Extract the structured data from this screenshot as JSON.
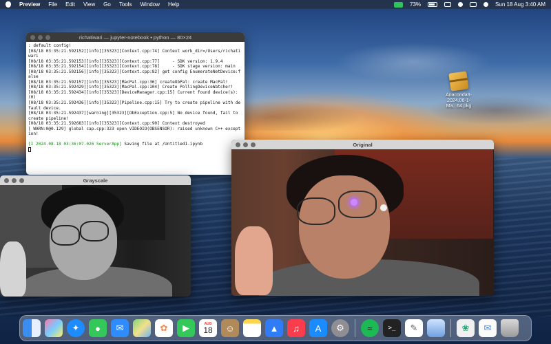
{
  "menubar": {
    "app": "Preview",
    "menus": [
      "File",
      "Edit",
      "View",
      "Go",
      "Tools",
      "Window",
      "Help"
    ],
    "battery": "73%",
    "datetime": "Sun 18 Aug  3:40 AM"
  },
  "terminal": {
    "title": "richatiwari — jupyter-notebook • python — 80×24",
    "lines": [
      ": default config!",
      "[08/18 03:35:21.592152][info][35323][Context.cpp:74] Context work_dir=/Users/richatiwari",
      "[08/18 03:35:21.592153][info][35323][Context.cpp:77]     - SDK version: 1.9.4",
      "[08/18 03:35:21.592154][info][35323][Context.cpp:78]     - SDK stage version: main",
      "[08/18 03:35:21.592156][info][35323][Context.cpp:82] get config EnumerateNetDevice:false",
      "[08/18 03:35:21.592157][info][35323][MacPal.cpp:36] createObPal: create MacPal!",
      "[08/18 03:35:21.592429][info][35323][MacPal.cpp:104] Create PollingDeviceWatcher!",
      "[08/18 03:35:21.592434][info][35323][DeviceManager.cpp:15] Current found device(s): (0)",
      "[08/18 03:35:21.592436][info][35323][Pipeline.cpp:15] Try to create pipeline with default device.",
      "[08/18 03:35:21.592437][warning][35323][ObException.cpp:5] No device found, fail to create pipeline!",
      "[08/18 03:35:21.592683][info][35323][Context.cpp:90] Context destroyed",
      "[ WARN:0@0.129] global cap.cpp:323 open VIDEOIO(OBSENSOR): raised unknown C++ exception!",
      ""
    ],
    "server_line_prefix": "[I 2024-08-18 03:36:07.026 ServerApp]",
    "server_line_msg": " Saving file at /Untitled1.ipynb"
  },
  "grayscale": {
    "title": "Grayscale"
  },
  "original": {
    "title": "Original"
  },
  "desktop_icon": {
    "label": "Anaconda3-2024.06-1-Ma...64.pkg"
  },
  "dock": {
    "calendar_month": "AUG",
    "calendar_day": "18",
    "items": [
      "finder-icon",
      "launchpad-icon",
      "safari-icon",
      "messages-icon",
      "mail-icon",
      "maps-icon",
      "photos-icon",
      "facetime-icon",
      "calendar-icon",
      "contacts-icon",
      "notes-icon",
      "keynote-icon",
      "music-icon",
      "app-store-icon",
      "system-settings-icon",
      "spotify-icon",
      "terminal-icon",
      "textedit-icon",
      "preview-icon",
      "python-icon",
      "mail-downloads-icon",
      "trash-icon"
    ]
  }
}
